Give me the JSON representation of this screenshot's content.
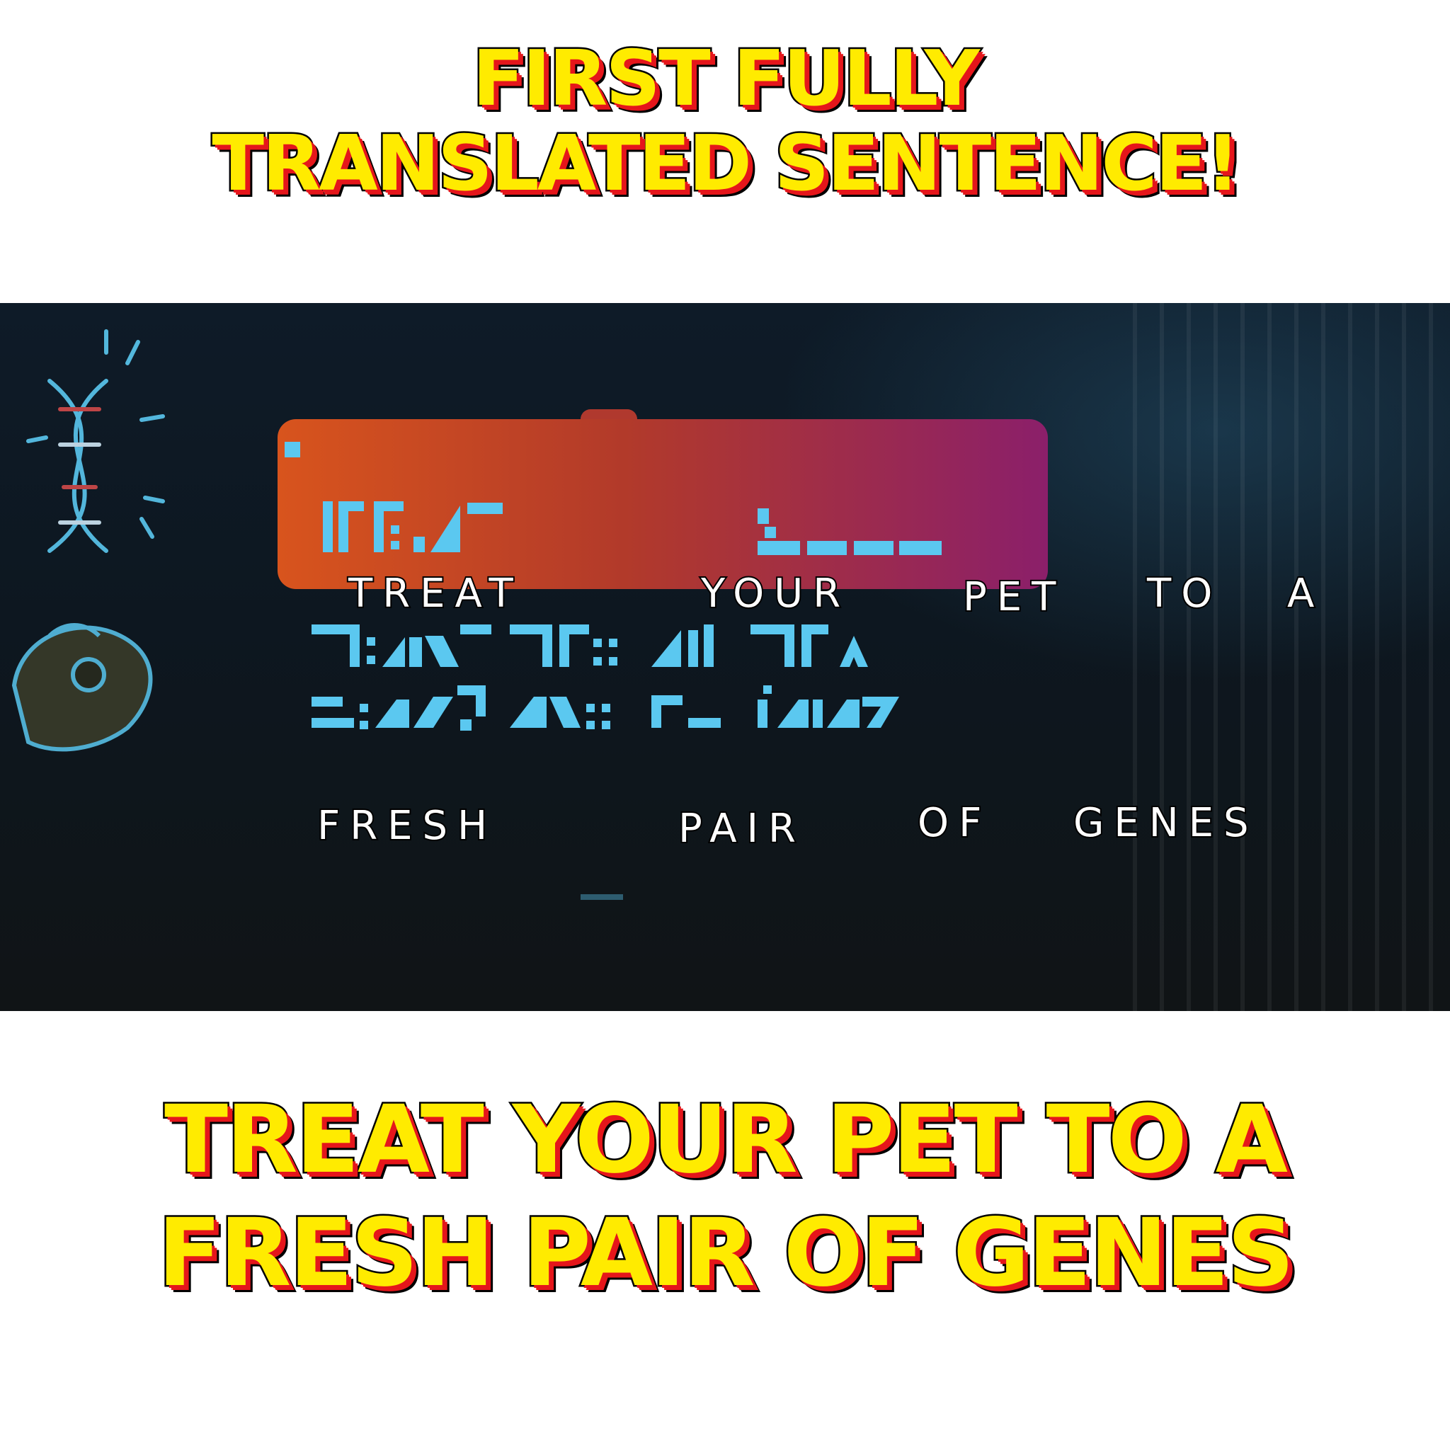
{
  "top_title": {
    "line1": "FIRST FULLY",
    "line2": "TRANSLATED SENTENCE!"
  },
  "captions": {
    "treat": "TREAT",
    "your": "YOUR",
    "pet": "PET",
    "to": "TO",
    "a": "A",
    "fresh": "FRESH",
    "pair": "PAIR",
    "of": "OF",
    "genes": "GENES"
  },
  "bottom_title": {
    "line1": "TREAT YOUR PET TO A",
    "line2": "FRESH PAIR OF GENES"
  },
  "colors": {
    "title_fill": "#ffeb00",
    "title_shadow": "#e5161b",
    "glyph": "#5bc8f0",
    "sign_left": "#d8541d",
    "sign_right": "#8b1f6a"
  },
  "icons": [
    "dna-icon",
    "pet-hand-icon"
  ]
}
